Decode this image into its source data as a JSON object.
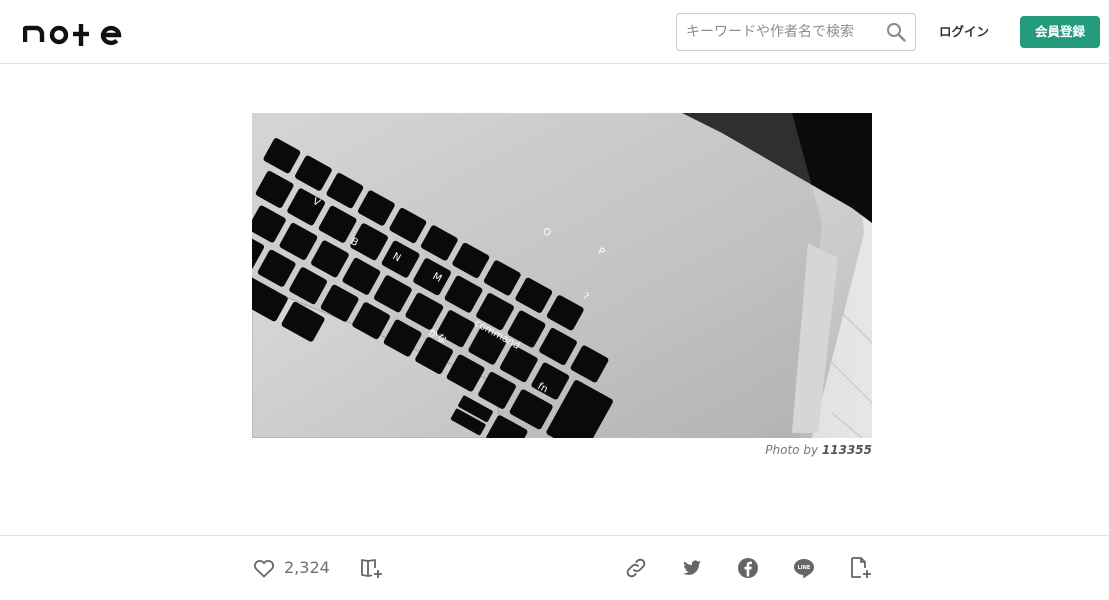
{
  "header": {
    "logo_text": "note",
    "search": {
      "placeholder": "キーワードや作者名で検索",
      "icon": "search-icon"
    },
    "login_label": "ログイン",
    "signup_label": "会員登録",
    "colors": {
      "signup_bg": "#249b7c",
      "signup_text": "#ffffff"
    }
  },
  "article": {
    "photo": {
      "description_icon": "keyboard-photo"
    },
    "credit": {
      "prefix": "Photo by",
      "name": "113355"
    }
  },
  "actions": {
    "like_icon": "heart-icon",
    "like_count": "2,324",
    "add_to_magazine_icon": "magazine-add-icon",
    "share_icons": [
      "link-icon",
      "twitter-icon",
      "facebook-icon",
      "line-icon",
      "note-add-icon"
    ]
  }
}
